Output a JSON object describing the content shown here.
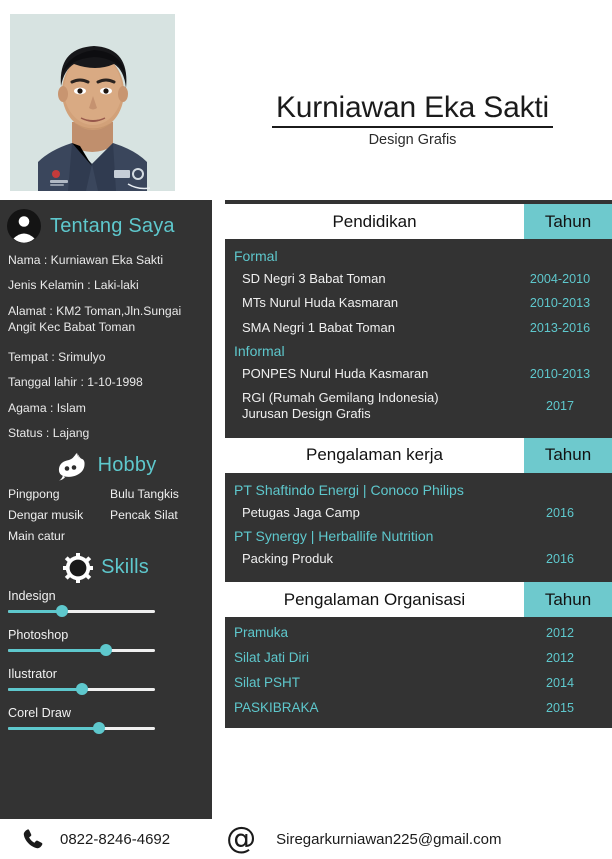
{
  "header": {
    "name": "Kurniawan Eka Sakti",
    "role": "Design Grafis",
    "photo_alt": "portrait-photo"
  },
  "sidebar": {
    "about": {
      "title": "Tentang Saya",
      "icon": "user-avatar-icon",
      "rows": [
        "Nama : Kurniawan Eka Sakti",
        "Jenis Kelamin : Laki-laki",
        "Alamat : KM2 Toman,Jln.Sungai\n           Angit Kec Babat Toman",
        "Tempat : Srimulyo",
        "Tanggal lahir : 1-10-1998",
        "Agama : Islam",
        "Status : Lajang"
      ]
    },
    "hobby": {
      "title": "Hobby",
      "icon": "hobby-mask-icon",
      "items": [
        "Pingpong",
        "Bulu Tangkis",
        "Dengar musik",
        "Pencak Silat",
        "Main catur"
      ]
    },
    "skills": {
      "title": "Skills",
      "icon": "gear-icon",
      "items": [
        {
          "name": "Indesign",
          "percent": 37
        },
        {
          "name": "Photoshop",
          "percent": 67
        },
        {
          "name": "Ilustrator",
          "percent": 50
        },
        {
          "name": "Corel Draw",
          "percent": 62
        }
      ]
    }
  },
  "sections": [
    {
      "title": "Pendidikan",
      "year_header": "Tahun",
      "groups": [
        {
          "subhead": "Formal",
          "rows": [
            {
              "label": "SD Negri 3 Babat Toman",
              "year": "2004-2010"
            },
            {
              "label": "MTs Nurul Huda Kasmaran",
              "year": "2010-2013"
            },
            {
              "label": "SMA Negri 1 Babat Toman",
              "year": "2013-2016"
            }
          ]
        },
        {
          "subhead": "Informal",
          "rows": [
            {
              "label": "PONPES Nurul Huda Kasmaran",
              "year": "2010-2013"
            },
            {
              "label": "RGI (Rumah Gemilang Indonesia)\nJurusan Design Grafis",
              "year": "2017"
            }
          ]
        }
      ]
    },
    {
      "title": "Pengalaman kerja",
      "year_header": "Tahun",
      "groups": [
        {
          "subhead": "PT Shaftindo Energi | Conoco Philips",
          "rows": [
            {
              "label": "Petugas Jaga Camp",
              "year": "2016"
            }
          ]
        },
        {
          "subhead": "PT Synergy | Herballife Nutrition",
          "rows": [
            {
              "label": "Packing Produk",
              "year": "2016"
            }
          ]
        }
      ]
    },
    {
      "title": "Pengalaman Organisasi",
      "year_header": "Tahun",
      "groups": [
        {
          "subhead": null,
          "rows": [
            {
              "label": "Pramuka",
              "year": "2012",
              "accent": true
            },
            {
              "label": "Silat Jati Diri",
              "year": "2012",
              "accent": true
            },
            {
              "label": "Silat PSHT",
              "year": "2014",
              "accent": true
            },
            {
              "label": "PASKIBRAKA",
              "year": "2015",
              "accent": true
            }
          ]
        }
      ]
    }
  ],
  "footer": {
    "phone_icon": "phone-icon",
    "phone": "0822-8246-4692",
    "email_icon": "at-sign-icon",
    "email": "Siregarkurniawan225@gmail.com"
  },
  "colors": {
    "teal": "#6ec9cd",
    "teal_text": "#5ec8cd",
    "dark": "#333333",
    "white": "#ffffff",
    "text_light": "#f0f0f0"
  }
}
